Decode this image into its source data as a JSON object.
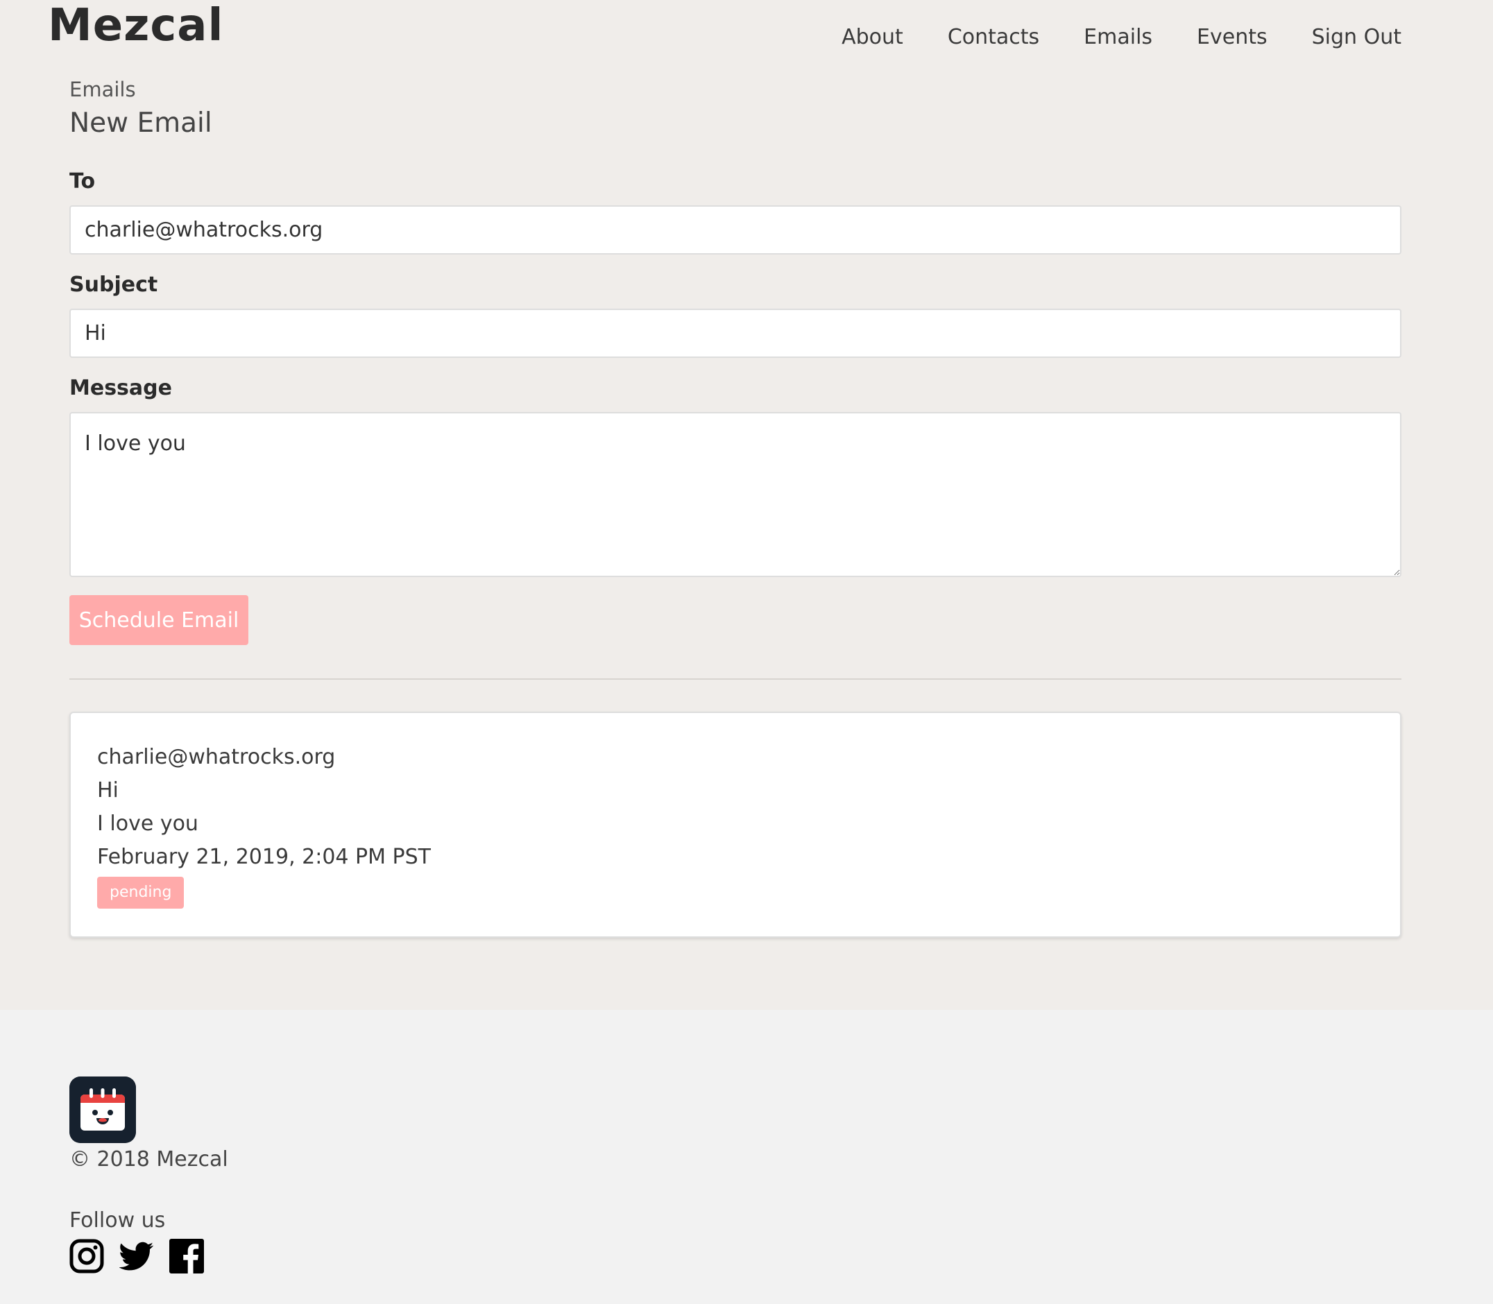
{
  "brand": {
    "name": "Mezcal"
  },
  "nav": {
    "items": [
      {
        "label": "About"
      },
      {
        "label": "Contacts"
      },
      {
        "label": "Emails"
      },
      {
        "label": "Events"
      },
      {
        "label": "Sign Out"
      }
    ]
  },
  "breadcrumb": "Emails",
  "page_title": "New Email",
  "form": {
    "to_label": "To",
    "to_value": "charlie@whatrocks.org",
    "subject_label": "Subject",
    "subject_value": "Hi",
    "message_label": "Message",
    "message_value": "I love you",
    "submit_label": "Schedule Email"
  },
  "scheduled_email": {
    "to": "charlie@whatrocks.org",
    "subject": "Hi",
    "message": "I love you",
    "datetime": "February 21, 2019, 2:04 PM PST",
    "status": "pending"
  },
  "footer": {
    "app_icon": "calendar-mascot-icon",
    "copyright": "© 2018 Mezcal",
    "follow_label": "Follow us",
    "social": [
      {
        "icon": "instagram-icon"
      },
      {
        "icon": "twitter-icon"
      },
      {
        "icon": "facebook-icon"
      }
    ]
  },
  "colors": {
    "accent": "#ffaaaa",
    "page_background": "#f0edea",
    "footer_background": "#f2f2f2"
  }
}
